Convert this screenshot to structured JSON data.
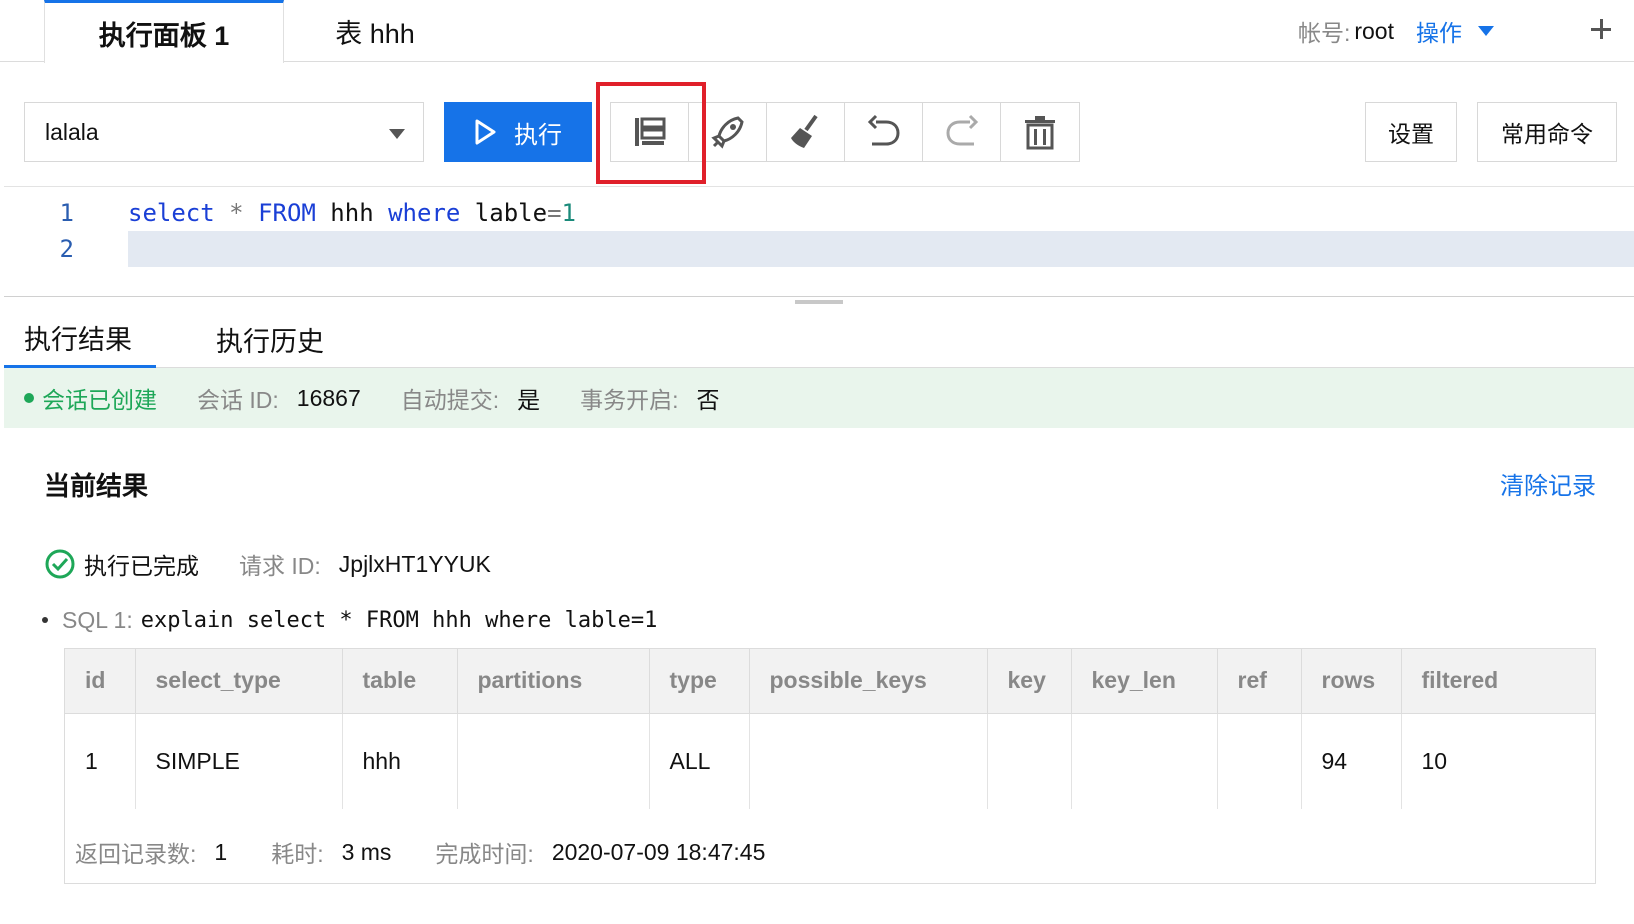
{
  "tabs": [
    {
      "label": "执行面板 1",
      "active": true
    },
    {
      "label": "表 hhh",
      "active": false
    }
  ],
  "account": {
    "label": "帐号:",
    "user": "root",
    "ops": "操作"
  },
  "toolbar": {
    "db_value": "lalala",
    "run_label": "执行",
    "tools": [
      "format-icon",
      "rocket-icon",
      "broom-icon",
      "undo-icon",
      "redo-icon",
      "trash-icon"
    ],
    "settings_label": "设置",
    "commands_label": "常用命令"
  },
  "editor": {
    "lines": [
      {
        "num": "1",
        "code": "select * FROM hhh where lable=1"
      },
      {
        "num": "2",
        "code": ""
      }
    ]
  },
  "result_tabs": [
    {
      "label": "执行结果",
      "active": true
    },
    {
      "label": "执行历史",
      "active": false
    }
  ],
  "session": {
    "status": "会话已创建",
    "id_label": "会话 ID:",
    "id_value": "16867",
    "autocommit_label": "自动提交:",
    "autocommit_value": "是",
    "txn_label": "事务开启:",
    "txn_value": "否"
  },
  "results": {
    "title": "当前结果",
    "clear_label": "清除记录",
    "done_label": "执行已完成",
    "request_label": "请求 ID:",
    "request_id": "JpjlxHT1YYUK",
    "sql_label": "SQL 1:",
    "sql_text": "explain select * FROM hhh where lable=1",
    "columns": [
      "id",
      "select_type",
      "table",
      "partitions",
      "type",
      "possible_keys",
      "key",
      "key_len",
      "ref",
      "rows",
      "filtered"
    ],
    "rows": [
      [
        "1",
        "SIMPLE",
        "hhh",
        "",
        "ALL",
        "",
        "",
        "",
        "",
        "94",
        "10"
      ]
    ],
    "footer": {
      "count_label": "返回记录数:",
      "count_value": "1",
      "time_label": "耗时:",
      "time_value": "3 ms",
      "finish_label": "完成时间:",
      "finish_value": "2020-07-09 18:47:45"
    }
  },
  "colors": {
    "accent": "#1673e8",
    "success": "#1ea758",
    "highlight": "#e0202a"
  }
}
